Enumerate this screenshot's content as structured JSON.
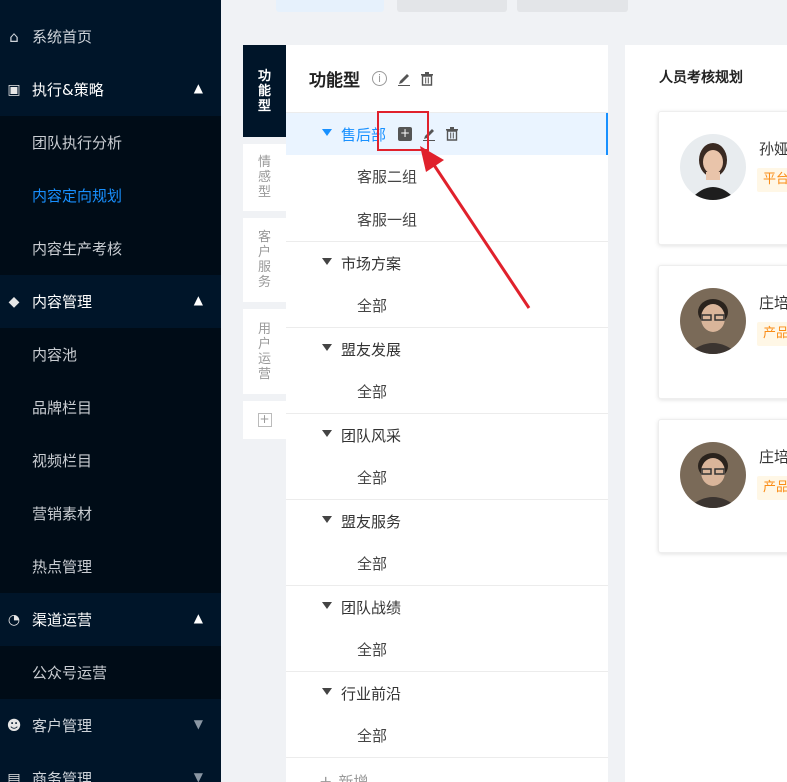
{
  "sidebar": {
    "home": "系统首页",
    "groups": [
      {
        "label": "执行&策略",
        "items": [
          "团队执行分析",
          "内容定向规划",
          "内容生产考核"
        ],
        "active": "内容定向规划"
      },
      {
        "label": "内容管理",
        "items": [
          "内容池",
          "品牌栏目",
          "视频栏目",
          "营销素材",
          "热点管理"
        ]
      },
      {
        "label": "渠道运营",
        "items": [
          "公众号运营"
        ]
      },
      {
        "label": "客户管理",
        "items": []
      },
      {
        "label": "商务管理",
        "items": []
      }
    ]
  },
  "vertical_tabs": [
    "功能型",
    "情感型",
    "客户服务",
    "用户运营"
  ],
  "tree": {
    "title": "功能型",
    "nodes": [
      {
        "label": "售后部",
        "children": [
          "客服二组",
          "客服一组"
        ]
      },
      {
        "label": "市场方案",
        "children": [
          "全部"
        ]
      },
      {
        "label": "盟友发展",
        "children": [
          "全部"
        ]
      },
      {
        "label": "团队风采",
        "children": [
          "全部"
        ]
      },
      {
        "label": "盟友服务",
        "children": [
          "全部"
        ]
      },
      {
        "label": "团队战绩",
        "children": [
          "全部"
        ]
      },
      {
        "label": "行业前沿",
        "children": [
          "全部"
        ]
      }
    ],
    "add_label": "新增"
  },
  "right_panel": {
    "title": "人员考核规划",
    "cards": [
      {
        "name": "孙娅",
        "tag": "平台"
      },
      {
        "name": "庄培",
        "tag": "产品"
      },
      {
        "name": "庄培",
        "tag": "产品"
      }
    ]
  },
  "colors": {
    "sidebar_bg": "#001529",
    "accent": "#1890ff",
    "annotation": "#e0212c"
  }
}
